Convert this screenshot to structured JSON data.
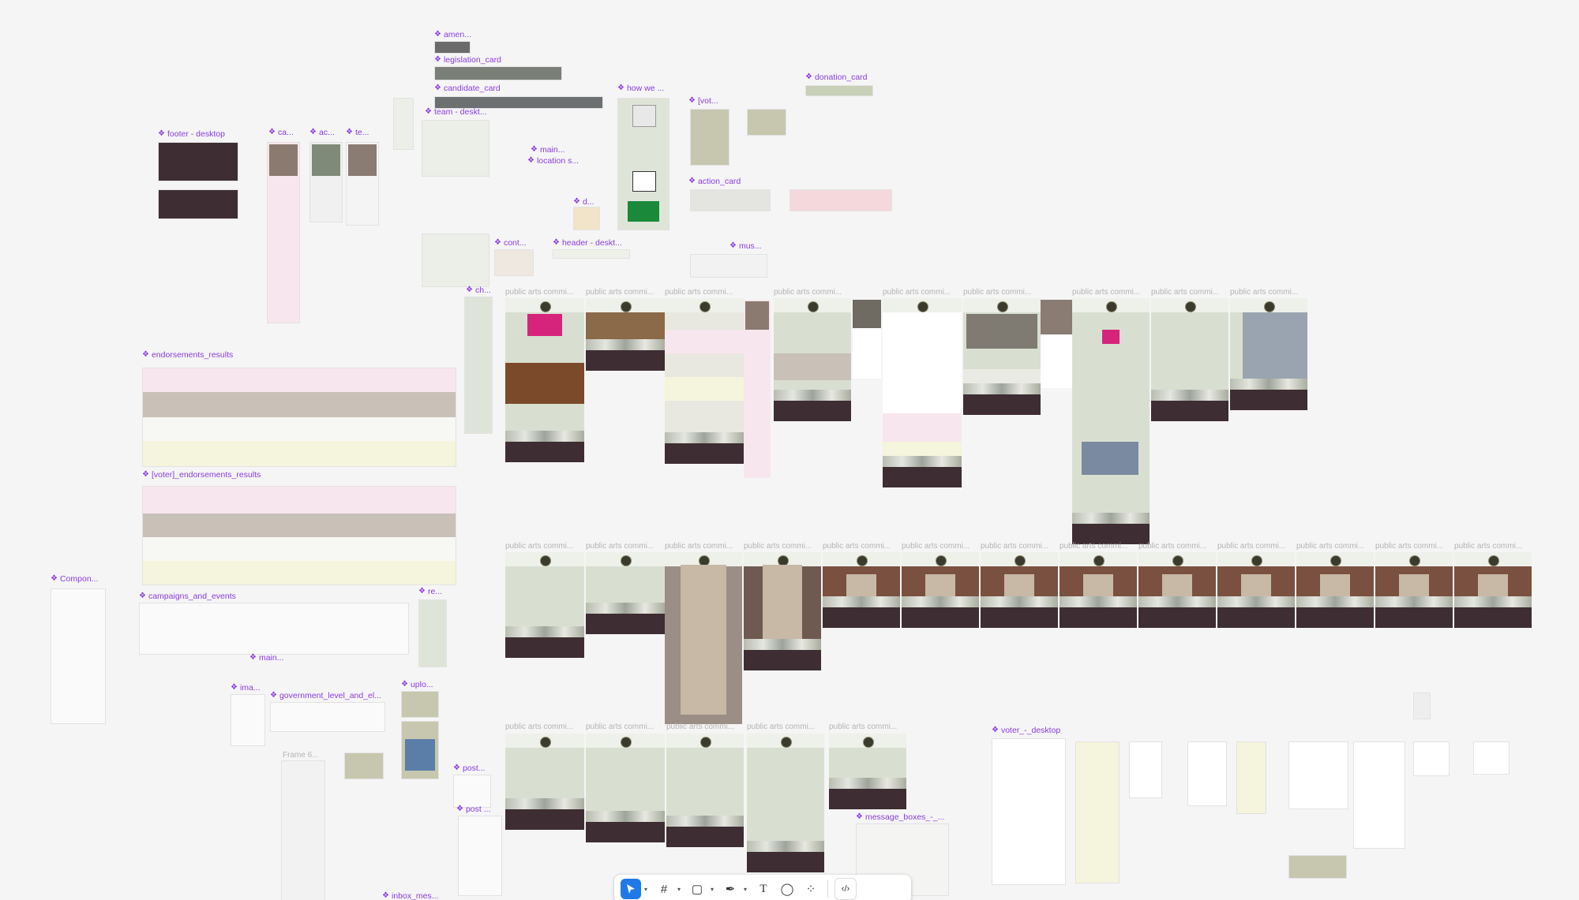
{
  "labels": {
    "amen": "amen...",
    "legislation_card": "legislation_card",
    "candidate_card": "candidate_card",
    "how_we": "how we ...",
    "vot": "[vot...",
    "donation_card": "donation_card",
    "team_deskt": "team - deskt...",
    "footer_desktop": "footer - desktop",
    "ca": "ca...",
    "ac": "ac...",
    "te": "te...",
    "main1": "main...",
    "location_s": "location s...",
    "action_card": "action_card",
    "d": "d...",
    "cont": "cont...",
    "header_deskt": "header - deskt...",
    "mus": "mus...",
    "ch": "ch...",
    "endorsements_results": "endorsements_results",
    "voter_endorsements_results": "[voter]_endorsements_results",
    "compon": "Compon...",
    "campaigns_and_events": "campaigns_and_events",
    "re": "re...",
    "main2": "main...",
    "ima": "ima...",
    "government_level": "government_level_and_el...",
    "uplo": "uplo...",
    "frame6": "Frame 6...",
    "post1": "post...",
    "post2": "post ...",
    "message_boxes": "message_boxes_-_...",
    "inbox_mes": "inbox_mes...",
    "voter_desktop": "voter_-_desktop",
    "public_arts": "public arts commi..."
  },
  "toolbar": {
    "tools": [
      "move-tool",
      "frame-tool",
      "shape-tool",
      "pen-tool",
      "text-tool",
      "comment-tool",
      "actions-tool",
      "dev-mode-toggle"
    ],
    "active": "move-tool"
  },
  "colors": {
    "component_label": "#8a3ce0",
    "frame_bg": "#d8dfd0",
    "footer": "#3e2d33",
    "canvas": "#f5f5f5",
    "pink_row": "#f8e6ee",
    "taupe_row": "#c9c0b8",
    "cream_row": "#f5f4dc"
  }
}
